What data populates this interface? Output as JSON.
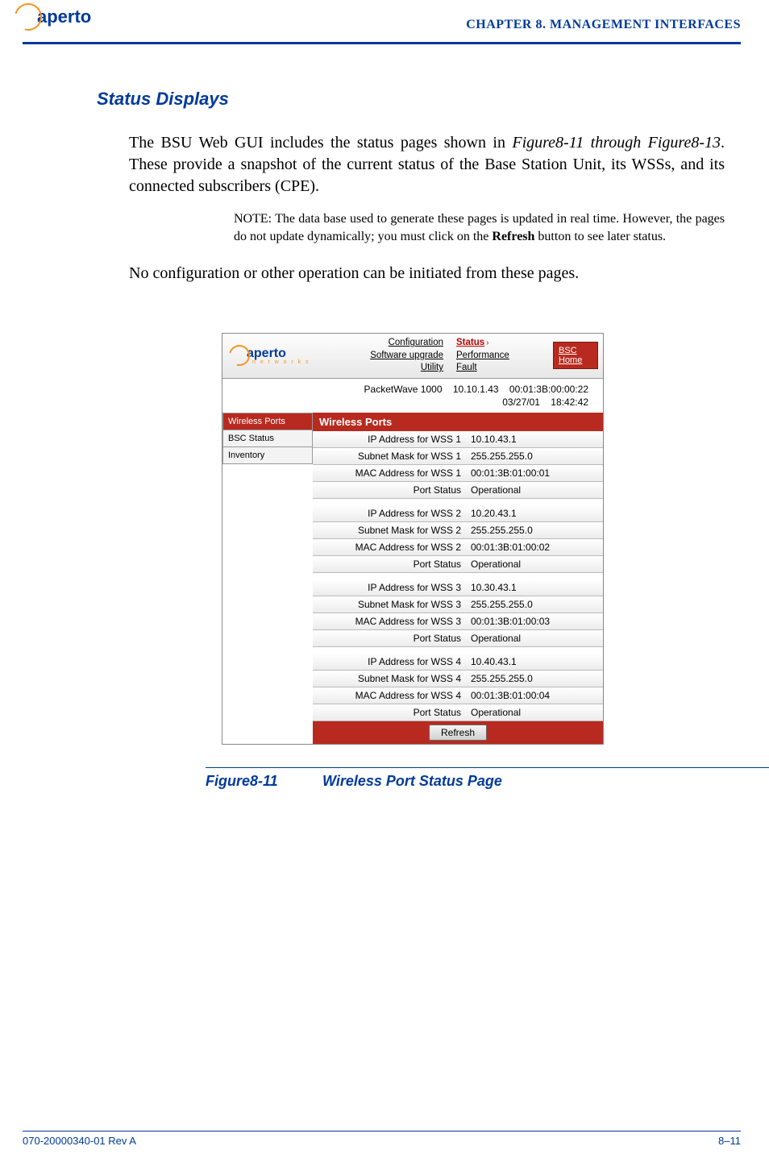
{
  "header": {
    "logo_text": "aperto",
    "chapter": "CHAPTER 8.  MANAGEMENT INTERFACES"
  },
  "section": {
    "heading": "Status Displays",
    "para1_a": "The BSU Web GUI includes the status pages shown in ",
    "para1_b": "Figure8-11 through Figure8-13",
    "para1_c": ". These provide a snapshot of the current status of the Base Station Unit, its WSSs, and its connected subscribers (CPE).",
    "note_label": "NOTE:",
    "note_body_a": "  The data base used to generate these pages is updated in real time. However, the pages do not update dynamically; you must click on the ",
    "note_bold": "Refresh",
    "note_body_b": " button to see later status.",
    "para2": "No configuration or other operation can be initiated from these pages."
  },
  "gui": {
    "logo_text": "aperto",
    "logo_sub": "n e t w o r k s",
    "topnav_col1": [
      "Configuration",
      "Software upgrade",
      "Utility"
    ],
    "topnav_col2": [
      "Status",
      "Performance",
      "Fault"
    ],
    "topnav_active": "Status",
    "home_label": "BSC Home",
    "infobar": {
      "device": "PacketWave 1000",
      "ip": "10.10.1.43",
      "mac": "00:01:3B:00:00:22"
    },
    "infobar2": {
      "date": "03/27/01",
      "time": "18:42:42"
    },
    "sidebar": [
      {
        "label": "Wireless Ports",
        "active": true
      },
      {
        "label": "BSC Status",
        "active": false
      },
      {
        "label": "Inventory",
        "active": false
      }
    ],
    "panel_title": "Wireless Ports",
    "ports": [
      {
        "n": "1",
        "ip": "10.10.43.1",
        "mask": "255.255.255.0",
        "mac": "00:01:3B:01:00:01",
        "status": "Operational"
      },
      {
        "n": "2",
        "ip": "10.20.43.1",
        "mask": "255.255.255.0",
        "mac": "00:01:3B:01:00:02",
        "status": "Operational"
      },
      {
        "n": "3",
        "ip": "10.30.43.1",
        "mask": "255.255.255.0",
        "mac": "00:01:3B:01:00:03",
        "status": "Operational"
      },
      {
        "n": "4",
        "ip": "10.40.43.1",
        "mask": "255.255.255.0",
        "mac": "00:01:3B:01:00:04",
        "status": "Operational"
      }
    ],
    "row_labels": {
      "ip": "IP Address for WSS ",
      "mask": "Subnet Mask for WSS ",
      "mac": "MAC Address for WSS ",
      "status": "Port Status"
    },
    "refresh_label": "Refresh"
  },
  "figure": {
    "number": "Figure8-11",
    "title": "Wireless Port Status Page"
  },
  "footer": {
    "left": "070-20000340-01 Rev A",
    "right": "8–11"
  }
}
